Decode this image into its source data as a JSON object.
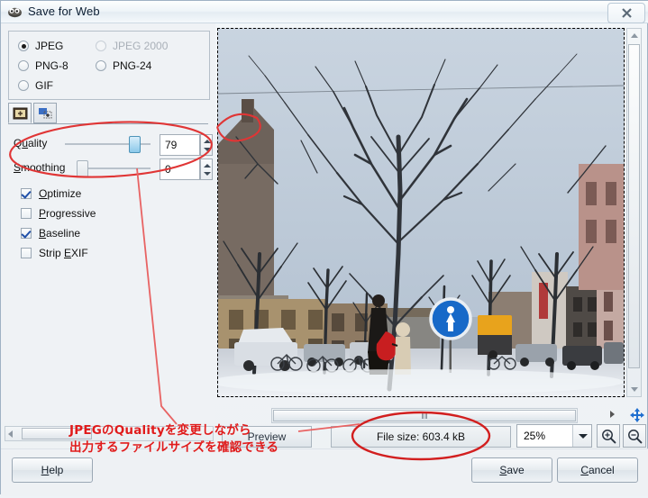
{
  "window": {
    "title": "Save for Web",
    "icon": "wilber-icon",
    "close_label": "✕"
  },
  "format": {
    "options": [
      {
        "label": "JPEG",
        "selected": true,
        "disabled": false
      },
      {
        "label": "JPEG 2000",
        "selected": false,
        "disabled": true
      },
      {
        "label": "PNG-8",
        "selected": false,
        "disabled": false
      },
      {
        "label": "PNG-24",
        "selected": false,
        "disabled": false
      },
      {
        "label": "GIF",
        "selected": false,
        "disabled": false
      }
    ]
  },
  "tabs": [
    {
      "name": "image-settings-tab",
      "selected": true
    },
    {
      "name": "advanced-settings-tab",
      "selected": false
    }
  ],
  "settings": {
    "quality": {
      "label_pre": "Q",
      "label_mn": "u",
      "label_post": "ality",
      "value": "79",
      "slider_percent": 79
    },
    "smoothing": {
      "label_pre": "",
      "label_mn": "S",
      "label_post": "moothing",
      "value": "0",
      "slider_percent": 0
    },
    "checkboxes": [
      {
        "pre": "",
        "mn": "O",
        "post": "ptimize",
        "checked": true
      },
      {
        "pre": "",
        "mn": "P",
        "post": "rogressive",
        "checked": false
      },
      {
        "pre": "",
        "mn": "B",
        "post": "aseline",
        "checked": true
      },
      {
        "pre": "Strip ",
        "mn": "E",
        "post": "XIF",
        "checked": false
      }
    ]
  },
  "statusbar": {
    "preview_label": "Preview",
    "file_size": "File size: 603.4 kB",
    "zoom_value": "25%",
    "zoom_in_icon": "zoom-in-icon",
    "zoom_out_icon": "zoom-out-icon",
    "nav_icon": "pan-navigate-icon",
    "hscroll_grip": "‖‖"
  },
  "buttons": {
    "help": {
      "pre": "",
      "mn": "H",
      "post": "elp"
    },
    "save": {
      "pre": "",
      "mn": "S",
      "post": "ave"
    },
    "cancel": {
      "pre": "",
      "mn": "C",
      "post": "ancel"
    }
  },
  "annotation": {
    "line1": "JPEGのQualityを変更しながら",
    "line2": "出力するファイルサイズを確認できる",
    "color": "#e01b1b"
  },
  "preview": {
    "alt": "Snowy city street with bare trees, parked cars and pedestrians",
    "zoom_percent": 25
  }
}
